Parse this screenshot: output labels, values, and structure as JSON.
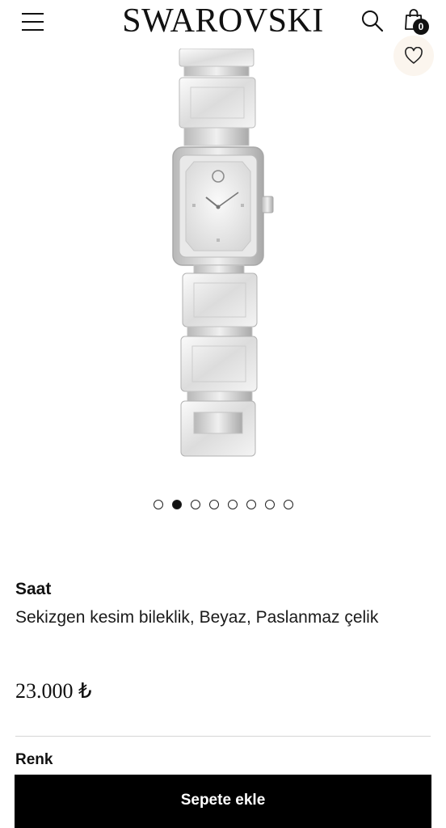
{
  "header": {
    "brand": "SWAROVSKI",
    "icons": {
      "menu": "hamburger-icon",
      "search": "search-icon",
      "cart": "shopping-bag-icon"
    },
    "cart_count": "0"
  },
  "gallery": {
    "wishlist_icon": "heart-icon",
    "image": "watch-product-image",
    "slide_count": 8,
    "active_slide": 2
  },
  "product": {
    "category": "Saat",
    "name": "Sekizgen kesim bileklik, Beyaz, Paslanmaz çelik",
    "price": "23.000 ₺",
    "color_label": "Renk"
  },
  "cta": {
    "add_to_cart_label": "Sepete ekle"
  },
  "colors": {
    "cta_bg": "#000000",
    "wishlist_bg": "#fbf5ee",
    "text": "#111111"
  }
}
